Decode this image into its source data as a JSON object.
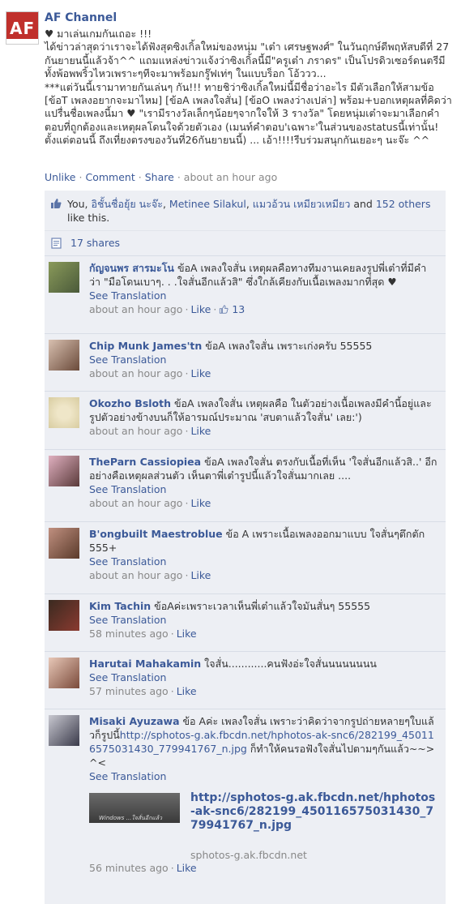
{
  "post": {
    "page_name": "AF Channel",
    "avatar_text": "AF",
    "text": "♥ มาเล่นเกมกันเถอะ !!!\nได้ข่าวล่าสุดว่าเราจะได้ฟังสุดซิงเกิ้ลใหม่ของหนุ่ม \"เต๋า เศรษฐพงศ์\" ในวันฤกษ์ดีพฤหัสบดีที่ 27 กันยายนนี้แล้วจ้า^^ แถมแหล่งข่าวแจ้งว่าซิงเกิ้ลนี้มี\"ครูเต๋า ภราดร\" เป็นโปรดิวเซอร์ดนตรีมีทั้งพ้อพพริ้วไหวเพราะๆทีจะมาพร้อมกรู๊ฟเท่ๆ ในแบบร็อก โอ้ววว...\n***แต่วันนี้เรามาทายกันเล่นๆ กัน!!! ทายชิว่าซิงเกิ้ลใหม่นี้มีชื่อว่าอะไร มีตัวเลือกให้สามข้อ [ข้อT เพลงอยากจะมาไหม] [ข้อA เพลงใจสั่น] [ข้อO เพลงว่างเปล่า] พร้อม+บอกเหตุผลที่คิดว่าแปรื่นชื่อเพลงนี้มา ♥ \"เรามีรางวัลเล็กๆน้อยๆจากใจให้ 3 รางวัล\" โดยหนุ่มเต๋าจะมาเลือกคำตอบที่ถูกต้องและเหตุผลโดนใจด้วยตัวเอง (เมนท์คำตอบ'เฉพาะ'ในส่วนของstatusนี้เท่านั้น! ตั้งแต่ตอนนี้ ถึงเที่ยงตรงของวันที่26กันยายนนี้) ... เอ้า!!!!รีบร่วมสนุกกันเยอะๆ นะจ๊ะ ^^",
    "actions": {
      "unlike": "Unlike",
      "comment": "Comment",
      "share": "Share",
      "time": "about an hour ago"
    }
  },
  "likes": {
    "you": "You, ",
    "name1": "อิชั้นชื่อยุ้ย นะจ๊ะ",
    "comma1": ", ",
    "name2": "Metinee Silakul",
    "comma2": ", ",
    "name3": "แมวอ้วน เหมียวเหมียว",
    "and": " and ",
    "others": "152 others",
    "tail": " like this."
  },
  "shares": {
    "label": "17 shares"
  },
  "comments": [
    {
      "author": "กัญจนพร สารมะโน",
      "text": " ข้อA เพลงใจสั่น เหตุผลคือทางทีมงานเคยลงรูปพี่เต๋าที่มีคำว่า \"มือโดนเบาๆ. . .ใจสั่นอีกแล้วสิ\" ซึ่งใกล้เคียงกับเนื้อเพลงมากที่สุด ♥",
      "translate": "See Translation",
      "time": "about an hour ago",
      "like": "Like",
      "likes": "13",
      "color": "#6b7a4a"
    },
    {
      "author": "Chip Munk James'tn",
      "text": " ข้อA เพลงใจสั่น เพราะเก่งครับ 55555",
      "translate": "See Translation",
      "time": "about an hour ago",
      "like": "Like",
      "color": "#8a6d5a"
    },
    {
      "author": "Okozho Bsloth",
      "text": " ข้อA เพลงใจสั่น เหตุผลคือ ในตัวอย่างเนื้อเพลงมีคำนี้อยู่และรูปตัวอย่างข้างบนก็ให้อารมณ์ประมาณ 'สบตาแล้วใจสั่น' เลย:')",
      "translate": "See Translation",
      "time": "about an hour ago",
      "like": "Like",
      "color": "#e8dfc0"
    },
    {
      "author": "TheParn Cassiopiea",
      "text": " ข้อA เพลงใจสั่น ตรงกับเนื้อที่เห็น 'ใจสั่นอีกแล้วสิ..' อีกอย่างคือเหตุผลส่วนตัว เห็นตาพี่เต๋ารูปนี้แล้วใจสั่นมากเลย ....",
      "translate": "See Translation",
      "time": "about an hour ago",
      "like": "Like",
      "color": "#b06a6a"
    },
    {
      "author": "B'ongbuilt Maestroblue",
      "text": " ข้อ A เพราะเนื้อเพลงออกมาแบบ ใจสั่นๆตึกตัก 555+",
      "translate": "See Translation",
      "time": "about an hour ago",
      "like": "Like",
      "color": "#7a5a4a"
    },
    {
      "author": "Kim Tachin",
      "text": " ข้อAค่ะเพราะเวลาเห็นพี่เต๋าแล้วใจมันสั่นๆ 55555",
      "translate": "See Translation",
      "time": "58 minutes ago",
      "like": "Like",
      "color": "#4a3a30"
    },
    {
      "author": "Harutai Mahakamin",
      "text": " ใจสั่น............คนฟังอ่ะใจสั่นนนนนนนน",
      "translate": "See Translation",
      "time": "57 minutes ago",
      "like": "Like",
      "color": "#9a6a5a"
    },
    {
      "author": "Misaki Ayuzawa",
      "text": " ข้อ Aค่ะ เพลงใจสั่น เพราะว่าคิดว่าจากรูปถ่ายหลายๆใบแล้วก็รูปนี้",
      "url": "http://sphotos-g.ak.fbcdn.net/hphotos-ak-snc6/282199_450116575031430_779941767_n.jpg",
      "text2": " ก็ทำให้คนรอฟังใจสั่นไปตามๆกันแล้ว~~>^<",
      "translate": "See Translation",
      "attachment": {
        "link": "http://sphotos-g.ak.fbcdn.net/hphotos-ak-snc6/282199_450116575031430_779941767_n.jpg",
        "source": "sphotos-g.ak.fbcdn.net",
        "thumb_text": "Windows ...ใจสั่นอีกแล้ว"
      },
      "time": "56 minutes ago",
      "like": "Like",
      "color": "#5a5a6a"
    }
  ]
}
